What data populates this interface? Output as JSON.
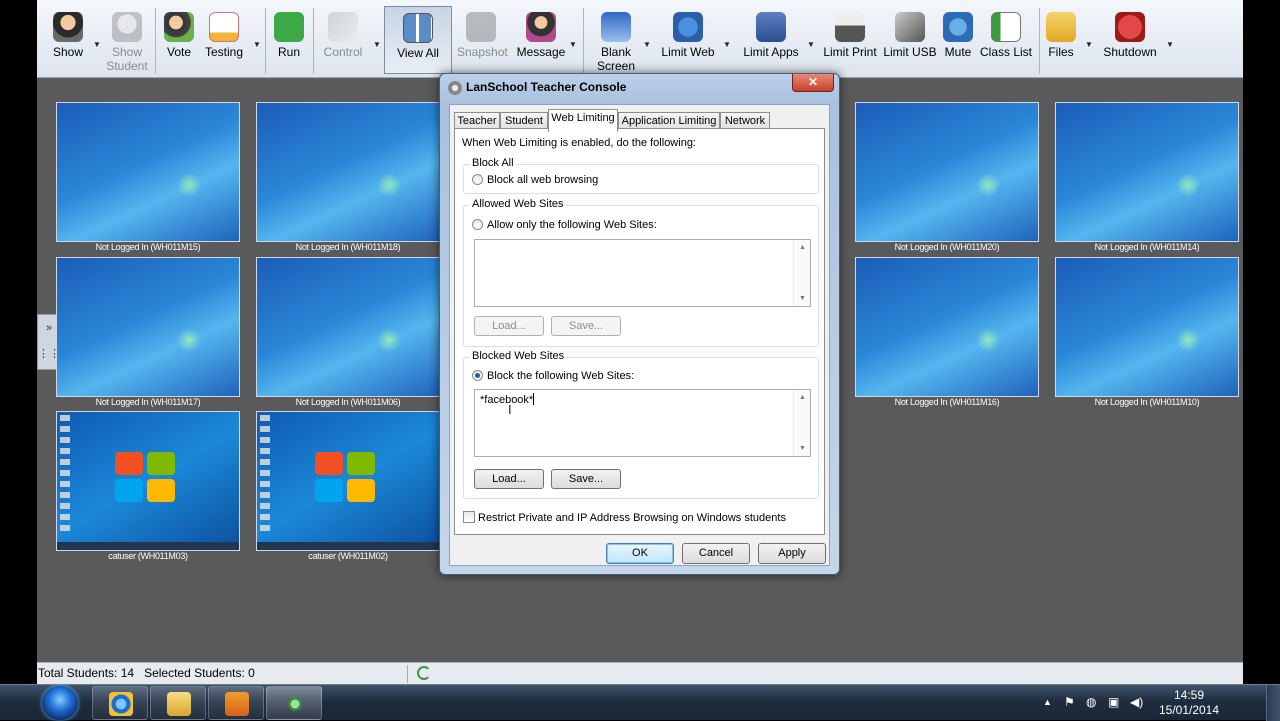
{
  "toolbar": {
    "buttons": [
      {
        "label": "Show",
        "icon": "show-icon"
      },
      {
        "label": "Show",
        "label2": "Student",
        "icon": "show-student-icon"
      },
      {
        "label": "Vote",
        "icon": "vote-icon"
      },
      {
        "label": "Testing",
        "icon": "testing-icon"
      },
      {
        "label": "Run",
        "icon": "run-icon"
      },
      {
        "label": "Control",
        "icon": "control-icon"
      },
      {
        "label": "View All",
        "icon": "view-all-icon"
      },
      {
        "label": "Snapshot",
        "icon": "snapshot-icon"
      },
      {
        "label": "Message",
        "icon": "message-icon"
      },
      {
        "label": "Blank",
        "label2": "Screen",
        "icon": "blank-screen-icon"
      },
      {
        "label": "Limit Web",
        "icon": "limit-web-icon"
      },
      {
        "label": "Limit Apps",
        "icon": "limit-apps-icon"
      },
      {
        "label": "Limit Print",
        "icon": "limit-print-icon"
      },
      {
        "label": "Limit USB",
        "icon": "limit-usb-icon"
      },
      {
        "label": "Mute",
        "icon": "mute-icon"
      },
      {
        "label": "Class List",
        "icon": "class-list-icon"
      },
      {
        "label": "Files",
        "icon": "files-icon"
      },
      {
        "label": "Shutdown",
        "icon": "shutdown-icon"
      }
    ]
  },
  "thumbnails": [
    {
      "label": "Not Logged In (WH011M15)"
    },
    {
      "label": "Not Logged In (WH011M18)"
    },
    {
      "label": "Not Logged In (WH011M20)"
    },
    {
      "label": "Not Logged In (WH011M14)"
    },
    {
      "label": "Not Logged In (WH011M17)"
    },
    {
      "label": "Not Logged In (WH011M06)"
    },
    {
      "label": "Not Logged In (WH011M16)"
    },
    {
      "label": "Not Logged In (WH011M10)"
    },
    {
      "label": "catuser (WH011M03)"
    },
    {
      "label": "catuser (WH011M02)"
    }
  ],
  "handle": {
    "top": "»",
    "bottom": "⋮⋮"
  },
  "status": {
    "text": "Total Students: 14   Selected Students: 0"
  },
  "dialog": {
    "title": "LanSchool Teacher Console",
    "close": "✕",
    "tabs": [
      "Teacher",
      "Student",
      "Web Limiting",
      "Application Limiting",
      "Network"
    ],
    "intro": "When Web Limiting is enabled, do the following:",
    "block_all": {
      "group": "Block All",
      "option": "Block all web browsing"
    },
    "allowed": {
      "group": "Allowed Web Sites",
      "option": "Allow only the following Web Sites:",
      "value": "",
      "load": "Load...",
      "save": "Save..."
    },
    "blocked": {
      "group": "Blocked Web Sites",
      "option": "Block the following Web Sites:",
      "value": "*facebook*",
      "load": "Load...",
      "save": "Save..."
    },
    "restrict": "Restrict Private and IP Address Browsing on Windows students",
    "ok": "OK",
    "cancel": "Cancel",
    "apply": "Apply"
  },
  "taskbar": {
    "time": "14:59",
    "date": "15/01/2014"
  }
}
